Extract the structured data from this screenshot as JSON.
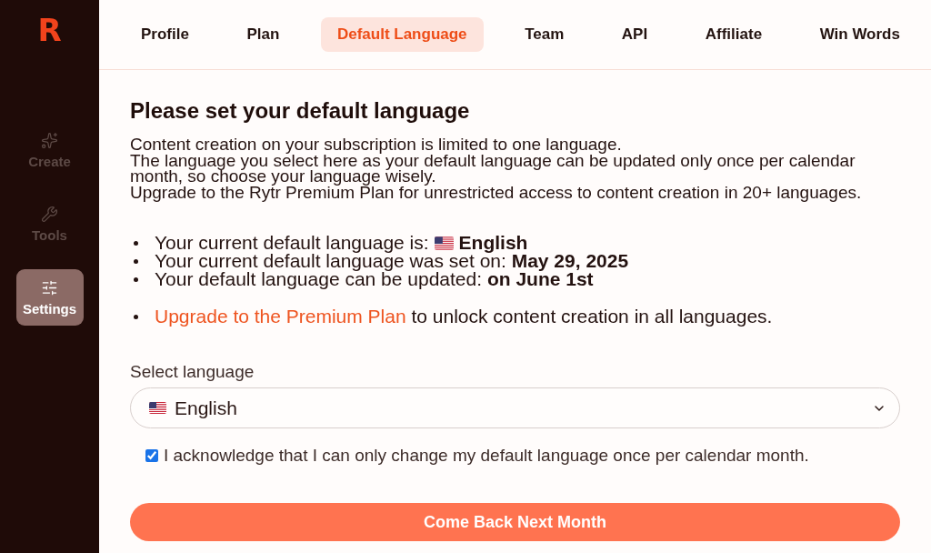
{
  "sidebar": {
    "logo": "R",
    "items": [
      {
        "label": "Create",
        "selected": false
      },
      {
        "label": "Tools",
        "selected": false
      },
      {
        "label": "Settings",
        "selected": true
      }
    ]
  },
  "tabs": [
    {
      "label": "Profile",
      "selected": false
    },
    {
      "label": "Plan",
      "selected": false
    },
    {
      "label": "Default Language",
      "selected": true
    },
    {
      "label": "Team",
      "selected": false
    },
    {
      "label": "API",
      "selected": false
    },
    {
      "label": "Affiliate",
      "selected": false
    },
    {
      "label": "Win Words",
      "selected": false
    }
  ],
  "content": {
    "title": "Please set your default language",
    "intro_lines": [
      "Content creation on your subscription is limited to one language.",
      "The language you select here as your default language can be updated only once per calendar month, so choose your language wisely.",
      "Upgrade to the Rytr Premium Plan for unrestricted access to content creation in 20+ languages."
    ],
    "facts": [
      {
        "label": "Your current default language is:",
        "flag": true,
        "value": "English"
      },
      {
        "label": "Your current default language was set on:",
        "flag": false,
        "value": "May 29, 2025"
      },
      {
        "label": "Your default language can be updated:",
        "flag": false,
        "value": "on June 1st"
      }
    ],
    "upgrade": {
      "link": "Upgrade to the Premium Plan",
      "text": "to unlock content creation in all languages."
    },
    "language_select": {
      "label": "Select language",
      "flag": true,
      "value": "English"
    },
    "acknowledge": {
      "label": "I acknowledge that I can only change my default language once per calendar month.",
      "checked": true
    },
    "button": {
      "label": "Come Back Next Month"
    }
  }
}
